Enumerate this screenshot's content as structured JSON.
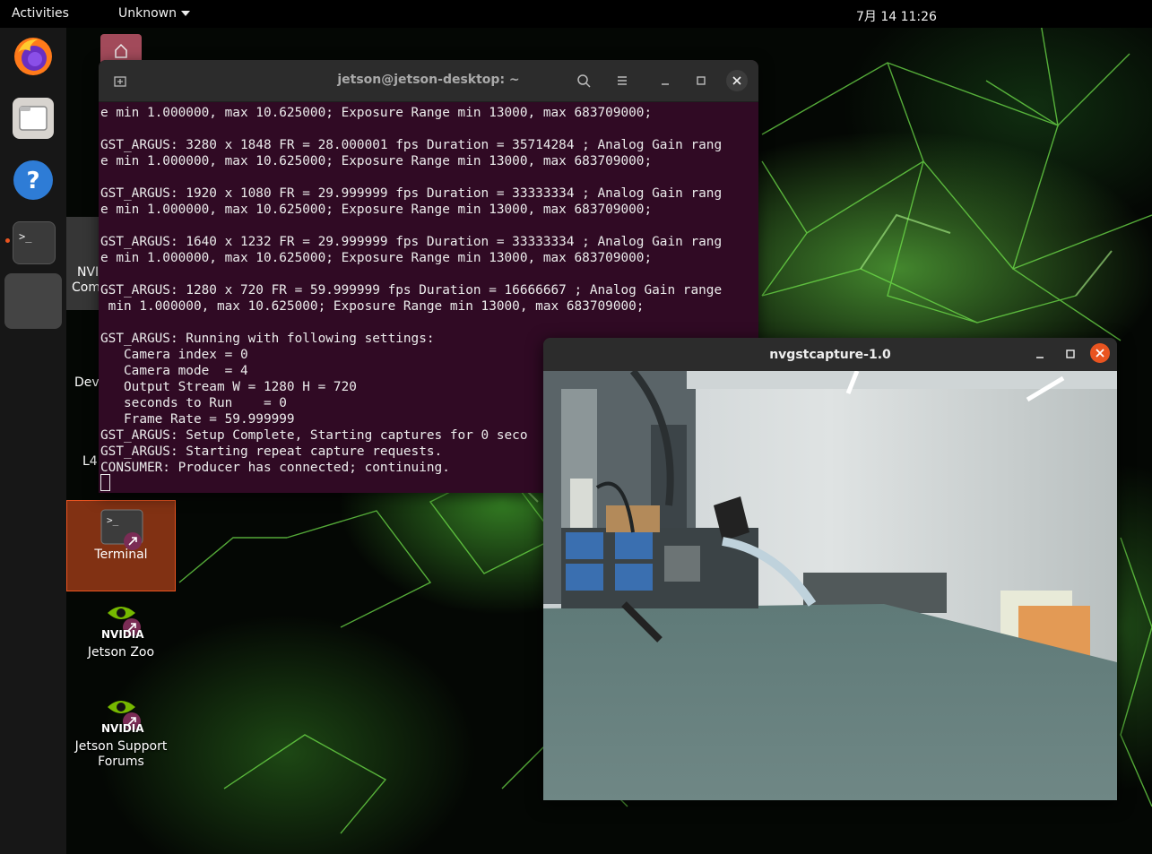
{
  "topbar": {
    "activities": "Activities",
    "app_menu": "Unknown",
    "clock": "7月 14  11:26"
  },
  "dock": {
    "items": [
      "firefox-icon",
      "files-icon",
      "help-icon",
      "terminal-icon",
      "app-icon"
    ]
  },
  "desktop": {
    "icons": [
      {
        "label": "Terminal"
      },
      {
        "label": "Jetson Zoo"
      },
      {
        "label": "Jetson Support Forums"
      }
    ],
    "partial_labels": [
      "NVI",
      "Com",
      "Dev",
      "L4"
    ],
    "nvidia_text": "NVIDIA"
  },
  "terminal": {
    "title": "jetson@jetson-desktop: ~",
    "lines": [
      "e min 1.000000, max 10.625000; Exposure Range min 13000, max 683709000;",
      "",
      "GST_ARGUS: 3280 x 1848 FR = 28.000001 fps Duration = 35714284 ; Analog Gain rang",
      "e min 1.000000, max 10.625000; Exposure Range min 13000, max 683709000;",
      "",
      "GST_ARGUS: 1920 x 1080 FR = 29.999999 fps Duration = 33333334 ; Analog Gain rang",
      "e min 1.000000, max 10.625000; Exposure Range min 13000, max 683709000;",
      "",
      "GST_ARGUS: 1640 x 1232 FR = 29.999999 fps Duration = 33333334 ; Analog Gain rang",
      "e min 1.000000, max 10.625000; Exposure Range min 13000, max 683709000;",
      "",
      "GST_ARGUS: 1280 x 720 FR = 59.999999 fps Duration = 16666667 ; Analog Gain range",
      " min 1.000000, max 10.625000; Exposure Range min 13000, max 683709000;",
      "",
      "GST_ARGUS: Running with following settings:",
      "   Camera index = 0",
      "   Camera mode  = 4",
      "   Output Stream W = 1280 H = 720",
      "   seconds to Run    = 0",
      "   Frame Rate = 59.999999",
      "GST_ARGUS: Setup Complete, Starting captures for 0 seco",
      "GST_ARGUS: Starting repeat capture requests.",
      "CONSUMER: Producer has connected; continuing."
    ]
  },
  "capture": {
    "title": "nvgstcapture-1.0"
  },
  "colors": {
    "accent": "#e95420",
    "terminal_bg": "#300a24",
    "header_bg": "#2c2c2c"
  }
}
